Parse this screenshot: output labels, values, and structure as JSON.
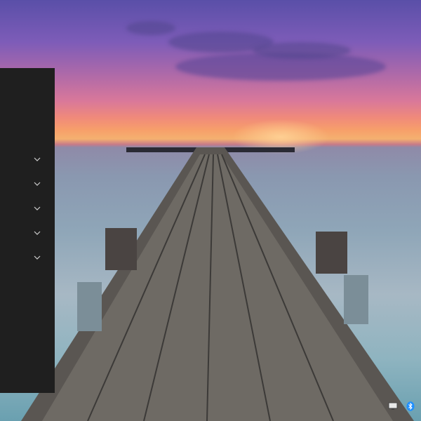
{
  "sidebar": {
    "expanders": [
      {
        "icon": "chevron-down-icon"
      },
      {
        "icon": "chevron-down-icon"
      },
      {
        "icon": "chevron-down-icon"
      },
      {
        "icon": "chevron-down-icon"
      },
      {
        "icon": "chevron-down-icon"
      }
    ]
  },
  "tray": {
    "icons": [
      "monitor-icon",
      "bluetooth-icon"
    ]
  },
  "colors": {
    "panel_bg": "#1f1f1f",
    "chevron": "#cfcfcf",
    "bluetooth": "#1e8fff"
  }
}
